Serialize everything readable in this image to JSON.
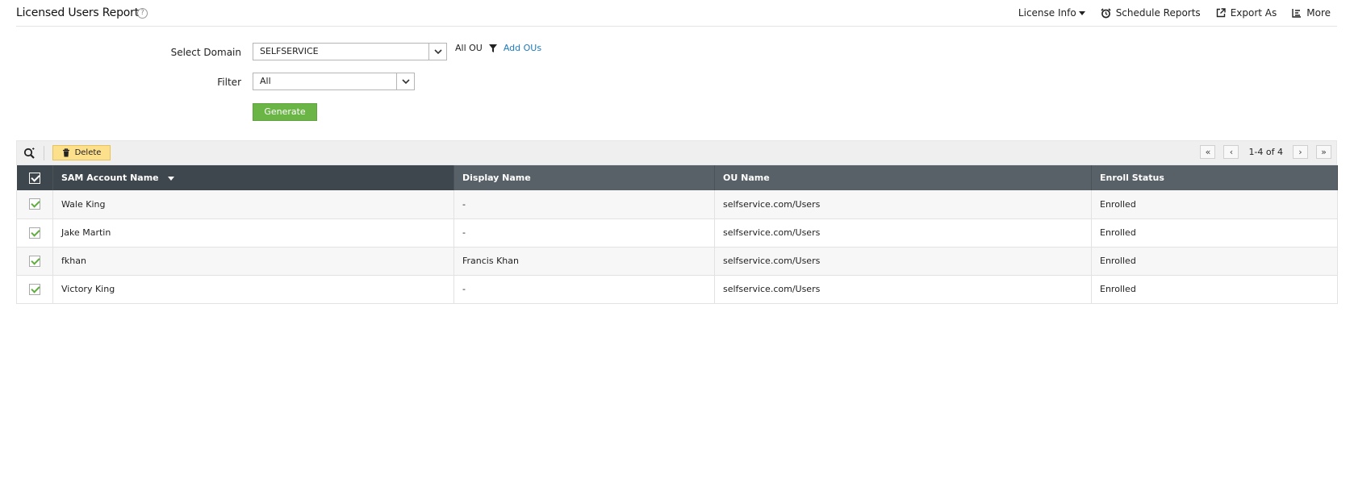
{
  "header": {
    "title": "Licensed Users Report",
    "help_glyph": "?",
    "actions": {
      "license_info": "License Info",
      "schedule_reports": "Schedule Reports",
      "export_as": "Export As",
      "more": "More"
    }
  },
  "form": {
    "domain_label": "Select Domain",
    "domain_value": "SELFSERVICE",
    "ou_scope": "All OU",
    "add_ous": "Add OUs",
    "filter_label": "Filter",
    "filter_value": "All",
    "generate_label": "Generate"
  },
  "toolbar": {
    "delete_label": "Delete",
    "page_info": "1-4 of 4"
  },
  "table": {
    "columns": [
      "SAM Account Name",
      "Display Name",
      "OU Name",
      "Enroll Status"
    ],
    "sorted_column": "SAM Account Name",
    "rows": [
      {
        "sam": "Wale King",
        "display": "-",
        "ou": "selfservice.com/Users",
        "status": "Enrolled",
        "checked": true
      },
      {
        "sam": "Jake Martin",
        "display": "-",
        "ou": "selfservice.com/Users",
        "status": "Enrolled",
        "checked": true
      },
      {
        "sam": "fkhan",
        "display": "Francis Khan",
        "ou": "selfservice.com/Users",
        "status": "Enrolled",
        "checked": true
      },
      {
        "sam": "Victory King",
        "display": "-",
        "ou": "selfservice.com/Users",
        "status": "Enrolled",
        "checked": true
      }
    ]
  },
  "colors": {
    "header_bg": "#586168",
    "sorted_header_bg": "#3f474e",
    "generate_green": "#6bb547",
    "delete_yellow": "#fde08c",
    "link_blue": "#1a7bc1",
    "check_green": "#5fae3d"
  }
}
